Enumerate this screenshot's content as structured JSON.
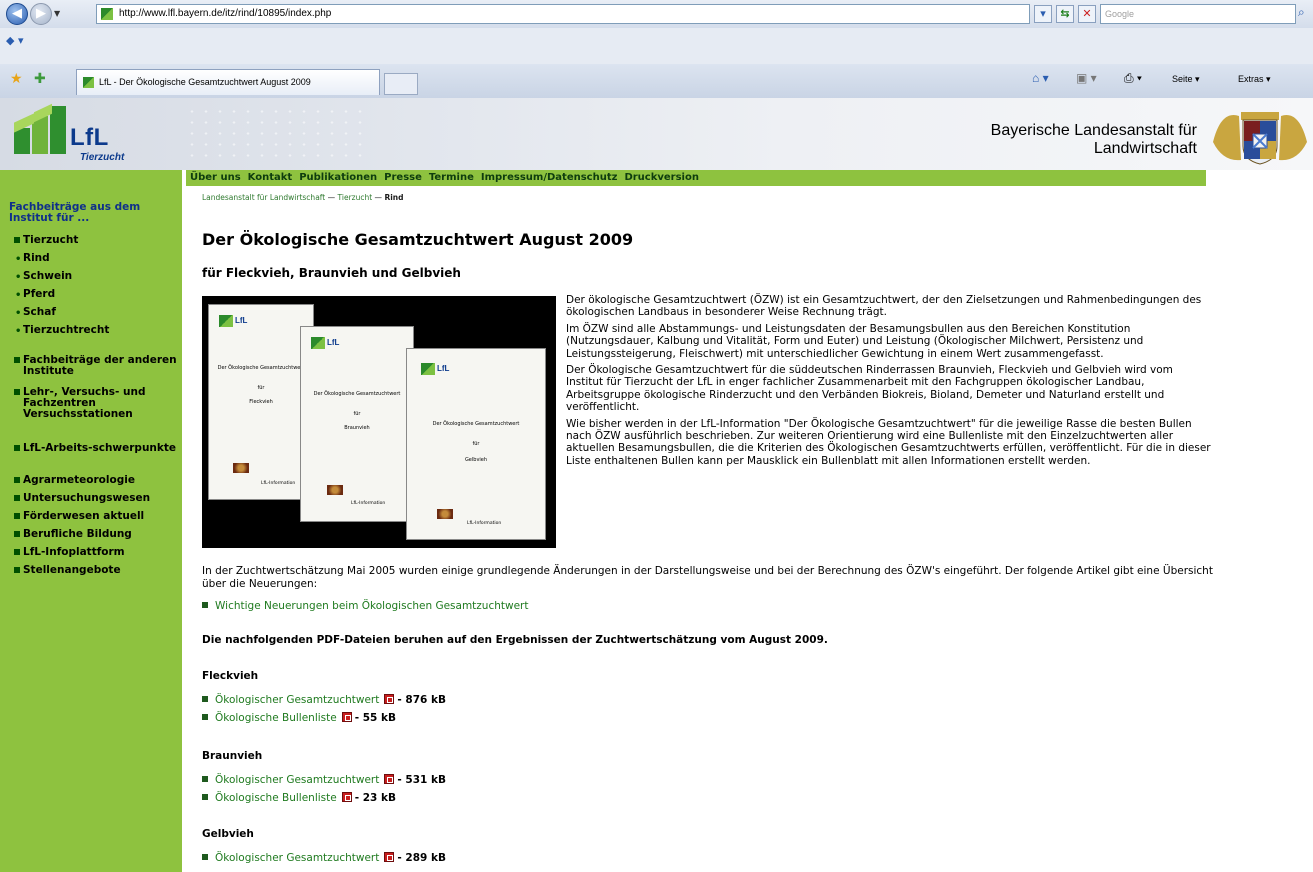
{
  "browser": {
    "url": "http://www.lfl.bayern.de/itz/rind/10895/index.php",
    "search_placeholder": "Google",
    "tab_title": "LfL - Der Ökologische Gesamtzuchtwert August 2009",
    "command_page": "Seite",
    "command_extras": "Extras"
  },
  "header": {
    "logo_text": "LfL",
    "logo_sub": "Tierzucht",
    "org_line1": "Bayerische Landesanstalt für",
    "org_line2": "Landwirtschaft"
  },
  "top_nav": [
    "Über uns",
    "Kontakt",
    "Publikationen",
    "Presse",
    "Termine",
    "Impressum/Datenschutz",
    "Druckversion"
  ],
  "sidebar": {
    "heading": "Fachbeiträge aus dem Institut für ...",
    "items": [
      {
        "label": "Tierzucht"
      },
      {
        "label": "Rind"
      },
      {
        "label": "Schwein"
      },
      {
        "label": "Pferd"
      },
      {
        "label": "Schaf"
      },
      {
        "label": "Tierzuchtrecht"
      },
      {
        "label": "Fachbeiträge der anderen Institute"
      },
      {
        "label": "Lehr-, Versuchs- und Fachzentren Versuchsstationen"
      },
      {
        "label": "LfL-Arbeits-schwerpunkte"
      },
      {
        "label": "Agrarmeteorologie"
      },
      {
        "label": "Untersuchungswesen"
      },
      {
        "label": "Förderwesen aktuell"
      },
      {
        "label": "Berufliche Bildung"
      },
      {
        "label": "LfL-Infoplattform"
      },
      {
        "label": "Stellenangebote"
      }
    ]
  },
  "breadcrumb": {
    "item1": "Landesanstalt für Landwirtschaft",
    "sep": "—",
    "item2": "Tierzucht",
    "current": "Rind"
  },
  "main": {
    "title": "Der Ökologische Gesamtzuchtwert August 2009",
    "subtitle": "für Fleckvieh, Braunvieh und Gelbvieh",
    "brochures": {
      "lfl": "LfL",
      "title_a": "Der Ökologische Gesamtzuchtwert",
      "fur": "für",
      "breed1": "Fleckvieh",
      "breed2": "Braunvieh",
      "breed3": "Gelbvieh",
      "info": "LfL-Information"
    },
    "intro_p1": "Der ökologische Gesamtzuchtwert (ÖZW) ist ein Gesamtzuchtwert, der den Zielsetzungen und Rahmenbedingungen des ökologischen Landbaus in besonderer Weise Rechnung trägt.",
    "intro_p2": "Im ÖZW sind alle Abstammungs- und Leistungsdaten der Besamungsbullen aus den Bereichen Konstitution (Nutzungsdauer, Kalbung und Vitalität, Form und Euter) und Leistung (Ökologischer Milchwert, Persistenz und Leistungssteigerung, Fleischwert) mit unterschiedlicher Gewichtung in einem Wert zusammengefasst.",
    "intro_p3": "Der Ökologische Gesamtzuchtwert für die süddeutschen Rinderrassen Braunvieh, Fleckvieh und Gelbvieh wird vom Institut für Tierzucht der LfL in enger fachlicher Zusammenarbeit mit den Fachgruppen ökologischer Landbau, Arbeitsgruppe ökologische Rinderzucht und den Verbänden Biokreis, Bioland, Demeter und Naturland erstellt und veröffentlicht.",
    "intro_p4": "Wie bisher werden in der LfL-Information \"Der Ökologische Gesamtzuchtwert\" für die jeweilige Rasse die besten Bullen nach ÖZW ausführlich beschrieben. Zur weiteren Orientierung wird eine Bullenliste mit den Einzelzuchtwerten aller aktuellen Besamungsbullen, die die Kriterien des Ökologischen Gesamtzuchtwerts erfüllen, veröffentlicht. Für die in dieser Liste enthaltenen Bullen kann per Mausklick ein Bullenblatt mit allen Informationen erstellt werden.",
    "note": "In der Zuchtwertschätzung Mai 2005 wurden einige grundlegende Änderungen in der Darstellungsweise und bei der Berechnung des ÖZW's eingeführt. Der folgende Artikel gibt eine Übersicht über die Neuerungen:",
    "news_link": "Wichtige Neuerungen beim Ökologischen Gesamtzuchtwert",
    "pdf_intro": "Die nachfolgenden PDF-Dateien beruhen auf den Ergebnissen der Zuchtwertschätzung vom August 2009.",
    "sections": [
      {
        "heading": "Fleckvieh",
        "links": [
          {
            "label": "Ökologischer Gesamtzuchtwert",
            "size": "- 876 kB"
          },
          {
            "label": "Ökologische Bullenliste",
            "size": "- 55 kB"
          }
        ]
      },
      {
        "heading": "Braunvieh",
        "links": [
          {
            "label": "Ökologischer Gesamtzuchtwert",
            "size": "- 531 kB"
          },
          {
            "label": "Ökologische Bullenliste",
            "size": "- 23 kB"
          }
        ]
      },
      {
        "heading": "Gelbvieh",
        "links": [
          {
            "label": "Ökologischer Gesamtzuchtwert",
            "size": "- 289 kB"
          }
        ]
      }
    ]
  },
  "colors": {
    "sidebar_green": "#8ec23f",
    "link_green": "#1f7a1f",
    "logo_blue": "#0c3a8c",
    "pdf_red": "#c81e1e"
  },
  "icons": [
    "back-icon",
    "forward-icon",
    "refresh-icon",
    "stop-icon",
    "search-icon",
    "favorites-star-icon",
    "add-favorite-icon",
    "home-icon",
    "feeds-icon",
    "print-icon",
    "pdf-icon"
  ]
}
